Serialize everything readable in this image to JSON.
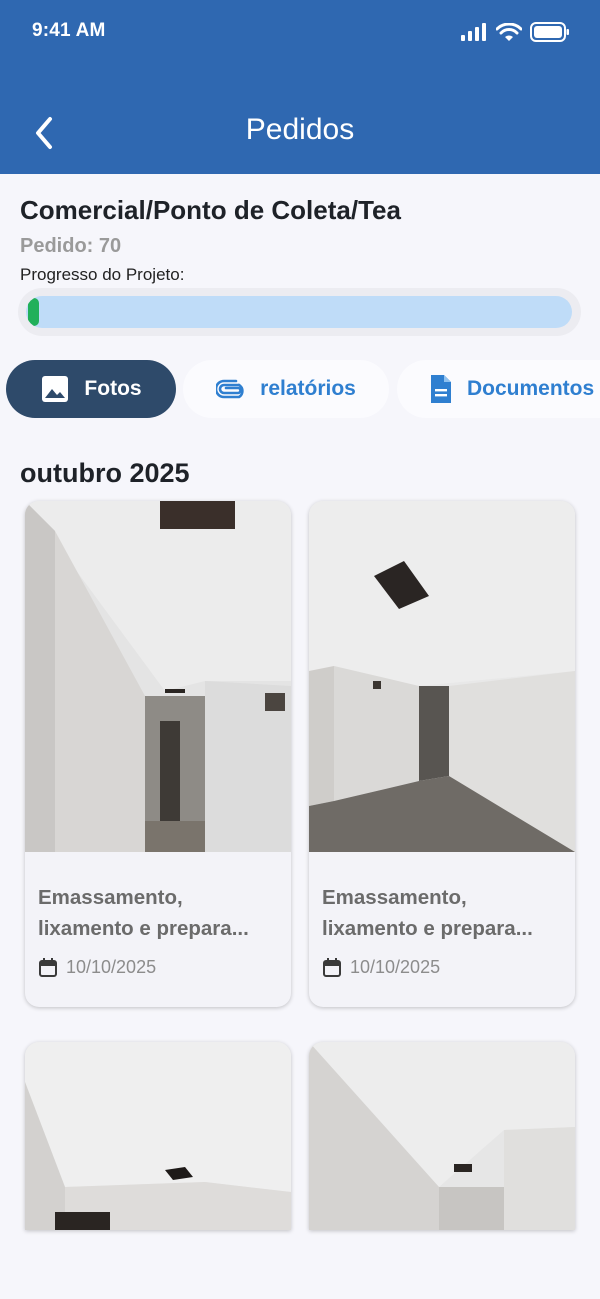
{
  "status_bar": {
    "time": "9:41 AM"
  },
  "nav": {
    "title": "Pedidos"
  },
  "project": {
    "title": "Comercial/Ponto de Coleta/Tea",
    "order": "Pedido: 70",
    "progress_label": "Progresso do Projeto:",
    "progress_fraction": 0.02
  },
  "tabs": [
    {
      "label": "Fotos",
      "icon": "image-icon",
      "active": true
    },
    {
      "label": "relatórios",
      "icon": "paperclip-icon",
      "active": false
    },
    {
      "label": "Documentos",
      "icon": "document-icon",
      "active": false
    }
  ],
  "month_header": "outubro 2025",
  "photos": [
    {
      "title_line1": "Emassamento,",
      "title_line2": "lixamento e prepara...",
      "date": "10/10/2025"
    },
    {
      "title_line1": "Emassamento,",
      "title_line2": "lixamento e prepara...",
      "date": "10/10/2025"
    },
    {
      "title_line1": "",
      "title_line2": "",
      "date": ""
    },
    {
      "title_line1": "",
      "title_line2": "",
      "date": ""
    }
  ],
  "colors": {
    "header": "#2f68b1",
    "tab_active": "#2e4a6a",
    "tab_text": "#2f7fd0",
    "progress_track": "#bfdcf8",
    "progress_fill": "#21b05a"
  }
}
